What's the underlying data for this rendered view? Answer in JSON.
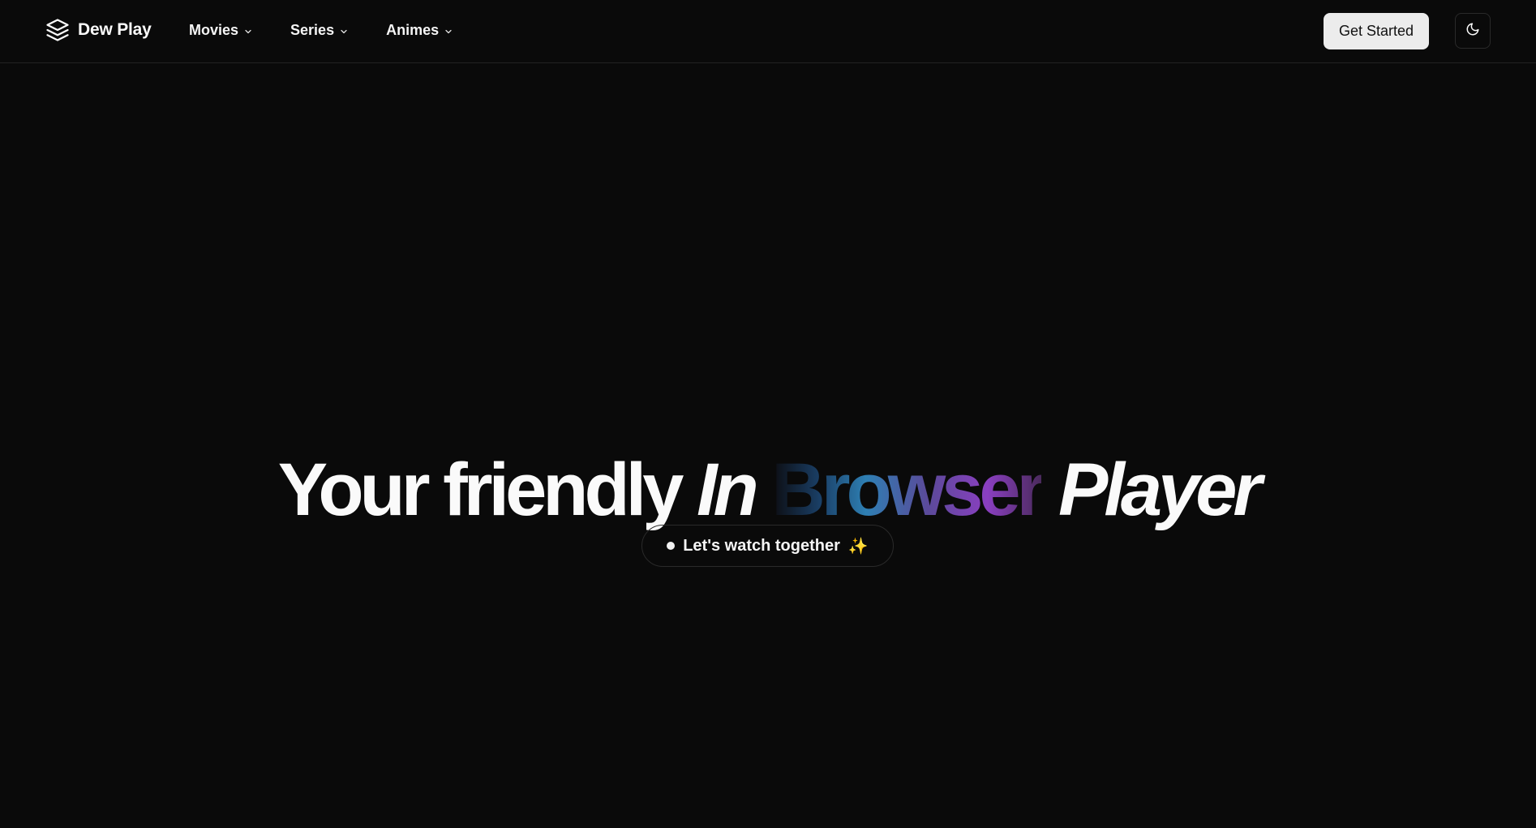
{
  "header": {
    "brand": {
      "name": "Dew Play",
      "icon": "layers-icon"
    },
    "nav": [
      {
        "label": "Movies",
        "icon": "chevron-down-icon"
      },
      {
        "label": "Series",
        "icon": "chevron-down-icon"
      },
      {
        "label": "Animes",
        "icon": "chevron-down-icon"
      }
    ],
    "cta_label": "Get Started",
    "theme_toggle_icon": "moon-icon"
  },
  "hero": {
    "title_part1": "Your friendly",
    "title_part2": "In",
    "title_highlight": "Browser",
    "title_part3": "Player",
    "pill_text": "Let's watch together",
    "pill_emoji": "✨"
  },
  "colors": {
    "background": "#0a0a0a",
    "button_bg": "#ececec",
    "gradient_start": "#1a3f66",
    "gradient_mid": "#2e7fb3",
    "gradient_end": "#8a3fc0"
  }
}
